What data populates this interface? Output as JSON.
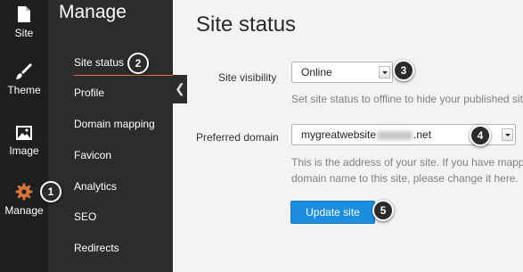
{
  "rail": {
    "items": [
      {
        "label": "Site",
        "icon": "page-icon"
      },
      {
        "label": "Theme",
        "icon": "paintbrush-icon"
      },
      {
        "label": "Image",
        "icon": "image-icon"
      },
      {
        "label": "Manage",
        "icon": "gear-icon"
      }
    ]
  },
  "panel": {
    "title": "Manage",
    "items": [
      "Site status",
      "Profile",
      "Domain mapping",
      "Favicon",
      "Analytics",
      "SEO",
      "Redirects"
    ],
    "active": "Site status"
  },
  "main": {
    "title": "Site status",
    "visibility": {
      "label": "Site visibility",
      "value": "Online",
      "help": "Set site status to offline to hide your published site."
    },
    "domain": {
      "label": "Preferred domain",
      "value_prefix": "mygreatwebsite",
      "value_suffix": ".net",
      "help_line1": "This is the address of your site. If you have mapped",
      "help_line2": "domain name to this site, please change it here."
    },
    "update_button": "Update site"
  },
  "steps": [
    "1",
    "2",
    "3",
    "4",
    "5"
  ],
  "colors": {
    "rail_bg": "#1f1f1f",
    "panel_bg": "#2c2c2c",
    "accent_orange": "#d6733e",
    "button_blue": "#1d8de0"
  }
}
